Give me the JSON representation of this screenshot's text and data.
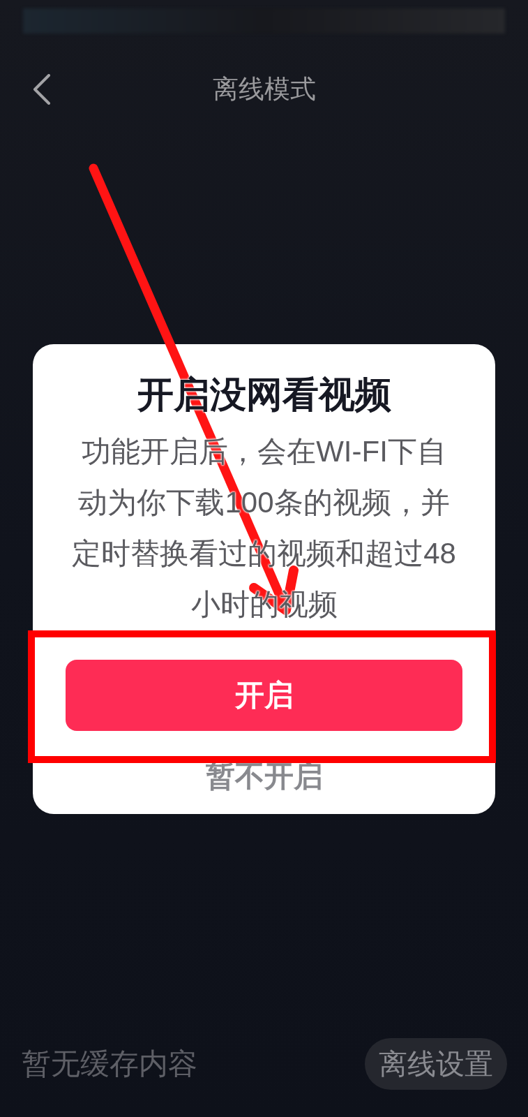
{
  "header": {
    "title": "离线模式"
  },
  "dialog": {
    "title": "开启没网看视频",
    "message": "功能开启后，会在WI-FI下自动为你下载100条的视频，并定时替换看过的视频和超过48小时的视频",
    "buttons": [
      {
        "label": "开启",
        "kind": "primary"
      },
      {
        "label": "暂不开启",
        "kind": "text"
      }
    ]
  },
  "footer": {
    "empty_message": "暂无缓存内容",
    "settings_button": "离线设置"
  },
  "annotations": {
    "arrow": true,
    "frame": true
  }
}
